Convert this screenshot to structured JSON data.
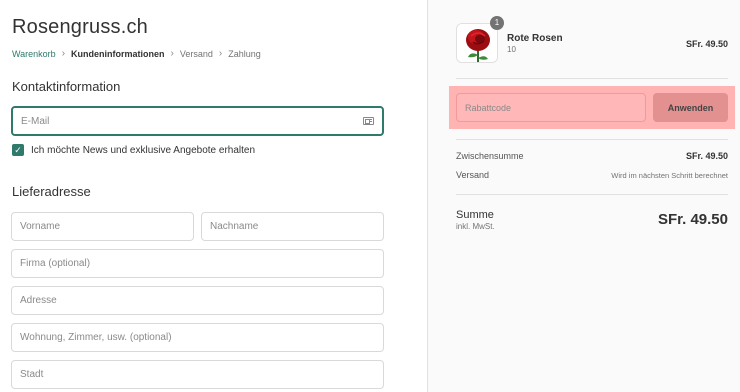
{
  "store": {
    "title": "Rosengruss.ch"
  },
  "breadcrumb": {
    "items": [
      "Warenkorb",
      "Kundeninformationen",
      "Versand",
      "Zahlung"
    ]
  },
  "contact": {
    "title": "Kontaktinformation",
    "email_placeholder": "E-Mail",
    "newsletter_label": "Ich möchte News und exklusive Angebote erhalten",
    "newsletter_checked": true
  },
  "shipping": {
    "title": "Lieferadresse",
    "first_name_placeholder": "Vorname",
    "last_name_placeholder": "Nachname",
    "company_placeholder": "Firma (optional)",
    "address_placeholder": "Adresse",
    "apartment_placeholder": "Wohnung, Zimmer, usw. (optional)",
    "city_placeholder": "Stadt"
  },
  "order": {
    "product": {
      "name": "Rote Rosen",
      "variant": "10",
      "quantity": "1",
      "price": "SFr. 49.50"
    },
    "discount": {
      "placeholder": "Rabattcode",
      "apply_label": "Anwenden"
    },
    "subtotal_label": "Zwischensumme",
    "subtotal_value": "SFr. 49.50",
    "shipping_label": "Versand",
    "shipping_value": "Wird im nächsten Schritt berechnet",
    "total_label": "Summe",
    "total_sub": "inkl. MwSt.",
    "total_value": "SFr. 49.50"
  },
  "colors": {
    "accent": "#2f7a6b",
    "highlight": "#ffb3b3"
  },
  "icons": [
    "card-icon",
    "check-icon",
    "chevron-right-icon",
    "rose-image"
  ]
}
